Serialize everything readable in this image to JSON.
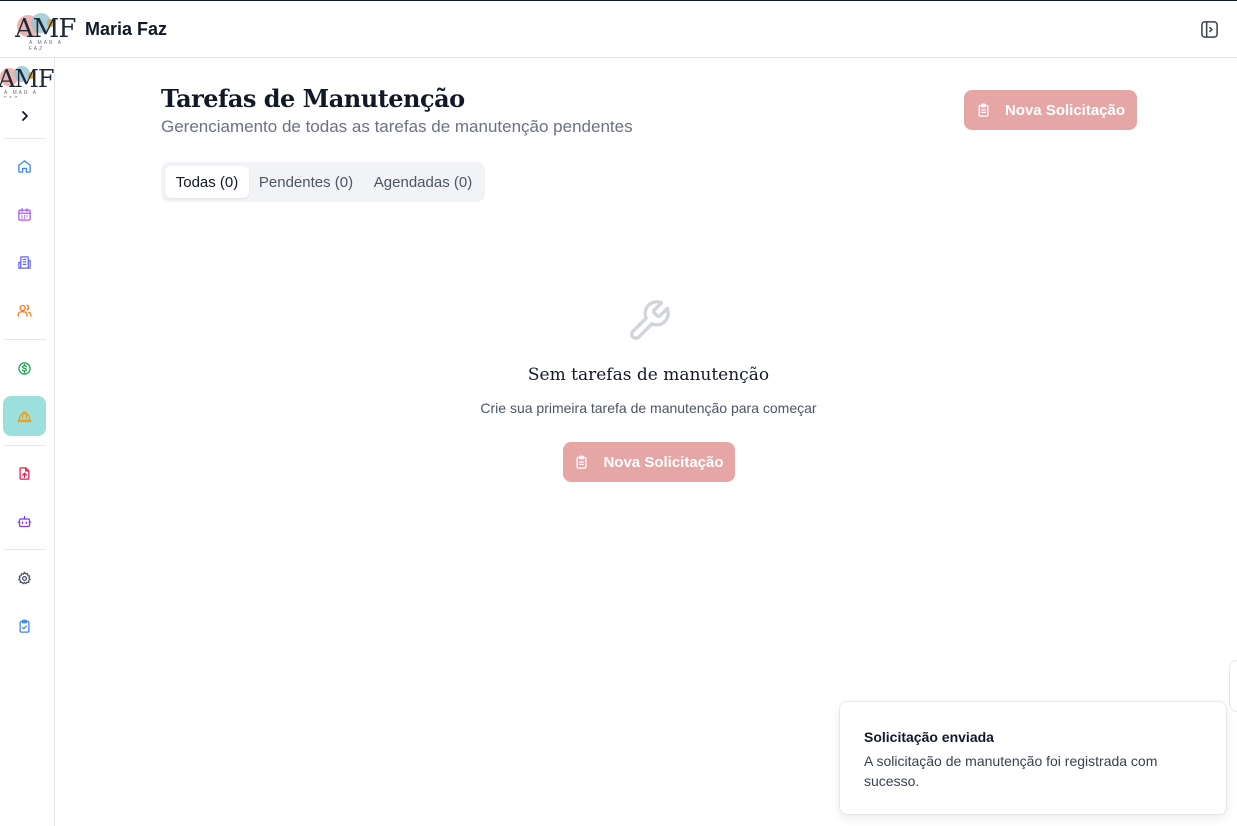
{
  "header": {
    "logo_text": "AMF",
    "logo_subtext": "A MAR A FAZ",
    "app_name": "Maria Faz",
    "toggle_icon": "panel-right-icon"
  },
  "sidebar": {
    "logo_text": "AMF",
    "logo_subtext": "A MAR A FAZ",
    "expand_icon": "chevron-right-icon",
    "items": [
      {
        "name": "home",
        "icon": "home-icon",
        "color": "#3b82f6"
      },
      {
        "name": "calendar",
        "icon": "calendar-icon",
        "color": "#a855f7"
      },
      {
        "name": "properties",
        "icon": "building-icon",
        "color": "#6366f1"
      },
      {
        "name": "owners",
        "icon": "users-icon",
        "color": "#f97316"
      },
      {
        "name": "finance",
        "icon": "dollar-circle-icon",
        "color": "#16a34a"
      },
      {
        "name": "maintenance",
        "icon": "hard-hat-icon",
        "color": "#f59e0b",
        "active": true
      },
      {
        "name": "documents",
        "icon": "file-upload-icon",
        "color": "#e11d48"
      },
      {
        "name": "assistant",
        "icon": "bot-icon",
        "color": "#7c3aed"
      },
      {
        "name": "settings",
        "icon": "gear-icon",
        "color": "#4b5563"
      },
      {
        "name": "tasks",
        "icon": "clipboard-check-icon",
        "color": "#3b82f6"
      }
    ]
  },
  "page": {
    "title": "Tarefas de Manutenção",
    "subtitle": "Gerenciamento de todas as tarefas de manutenção pendentes",
    "new_request_label": "Nova Solicitação",
    "new_request_icon": "clipboard-icon"
  },
  "tabs": [
    {
      "label": "Todas (0)",
      "active": true
    },
    {
      "label": "Pendentes (0)",
      "active": false
    },
    {
      "label": "Agendadas (0)",
      "active": false
    }
  ],
  "empty_state": {
    "icon": "wrench-icon",
    "title": "Sem tarefas de manutenção",
    "description": "Crie sua primeira tarefa de manutenção para começar",
    "button_label": "Nova Solicitação"
  },
  "toast": {
    "title": "Solicitação enviada",
    "message": "A solicitação de manutenção foi registrada com sucesso."
  },
  "colors": {
    "accent_button": "#e6a6a6",
    "active_nav": "#9ddfdc"
  }
}
